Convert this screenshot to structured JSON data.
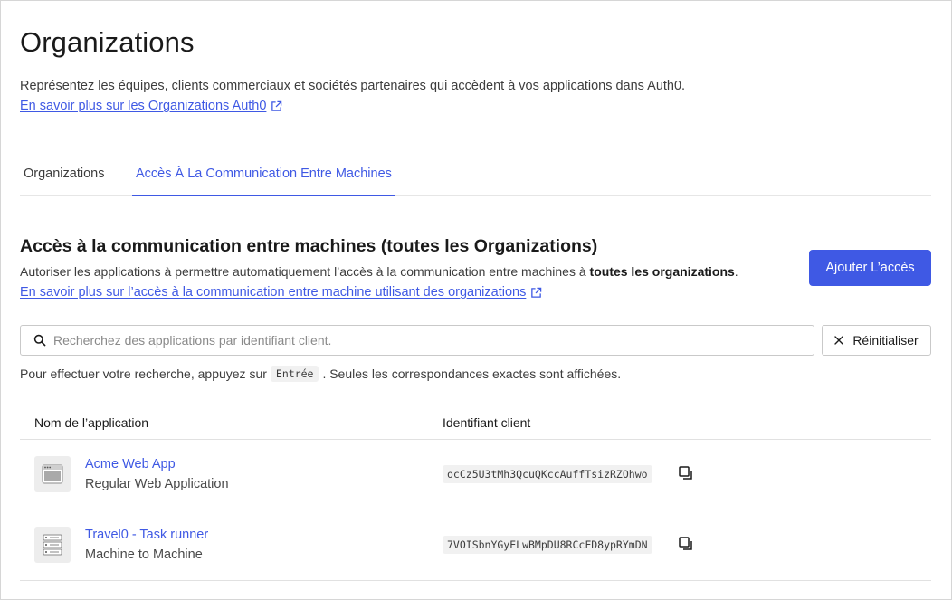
{
  "page": {
    "title": "Organizations",
    "description": "Représentez les équipes, clients commerciaux et sociétés partenaires qui accèdent à vos applications dans Auth0.",
    "learn_more": "En savoir plus sur les Organizations Auth0"
  },
  "tabs": [
    {
      "label": "Organizations",
      "active": false
    },
    {
      "label": "Accès À La Communication Entre Machines",
      "active": true
    }
  ],
  "section": {
    "title": "Accès à la communication entre machines (toutes les Organizations)",
    "desc_prefix": "Autoriser les applications à permettre automatiquement l’accès à la communication entre machines à ",
    "desc_bold": "toutes les organizations",
    "desc_suffix": ".",
    "learn_more": "En savoir plus sur l’accès à la communication entre machine utilisant des organizations",
    "add_button": "Ajouter L’accès"
  },
  "search": {
    "placeholder": "Recherchez des applications par identifiant client.",
    "value": "",
    "reset_label": "Réinitialiser",
    "hint_prefix": "Pour effectuer votre recherche, appuyez sur",
    "hint_key": "Entrée",
    "hint_suffix": ". Seules les correspondances exactes sont affichées."
  },
  "table": {
    "columns": [
      "Nom de l’application",
      "Identifiant client"
    ],
    "rows": [
      {
        "name": "Acme Web App",
        "type": "Regular Web Application",
        "client_id": "ocCz5U3tMh3QcuQKccAuffTsizRZOhwo",
        "icon": "web-app-icon"
      },
      {
        "name": "Travel0 - Task runner",
        "type": "Machine to Machine",
        "client_id": "7VOISbnYGyELwBMpDU8RCcFD8ypRYmDN",
        "icon": "server-icon"
      }
    ]
  },
  "colors": {
    "accent": "#3f59e4",
    "text": "#1a1a1a",
    "muted": "#3d3d3d",
    "border": "#c9c9c9"
  }
}
